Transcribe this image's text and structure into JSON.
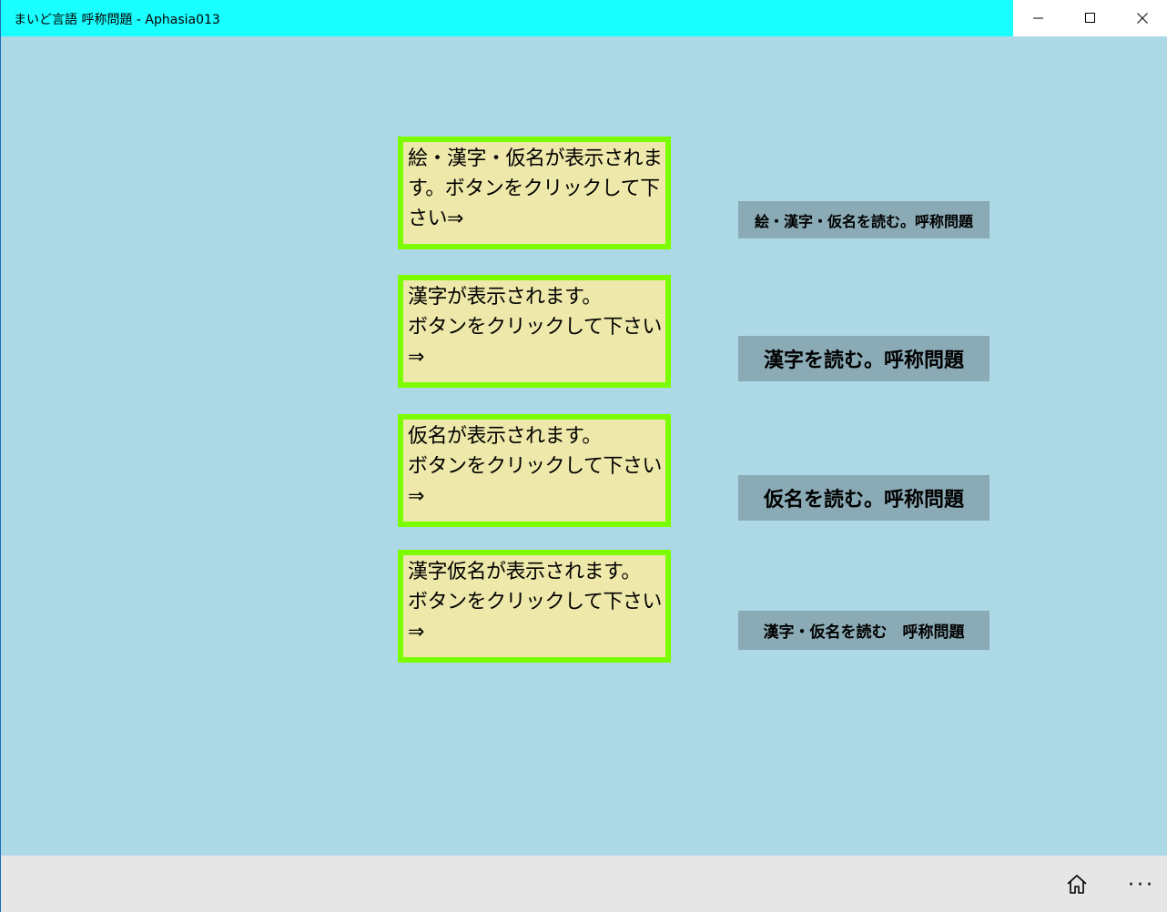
{
  "window": {
    "title": "まいど言語 呼称問題 - Aphasia013"
  },
  "colors": {
    "titlebar_accent": "#1affff",
    "background": "#add8e6",
    "prompt_fill": "#eee8aa",
    "prompt_border": "#7cfc00",
    "button_fill": "#8aaab5",
    "appbar": "#e6e6e6"
  },
  "prompts": [
    {
      "text": "絵・漢字・仮名が表示されます。ボタンをクリックして下さい⇒"
    },
    {
      "text": "漢字が表示されます。\nボタンをクリックして下さい⇒"
    },
    {
      "text": "仮名が表示されます。\nボタンをクリックして下さい⇒"
    },
    {
      "text": "漢字仮名が表示されます。\nボタンをクリックして下さい⇒"
    }
  ],
  "buttons": [
    {
      "label": "絵・漢字・仮名を読む。呼称問題"
    },
    {
      "label": "漢字を読む。呼称問題"
    },
    {
      "label": "仮名を読む。呼称問題"
    },
    {
      "label": "漢字・仮名を読む　呼称問題"
    }
  ],
  "appbar": {
    "home_icon": "home-icon",
    "more_label": "···"
  }
}
